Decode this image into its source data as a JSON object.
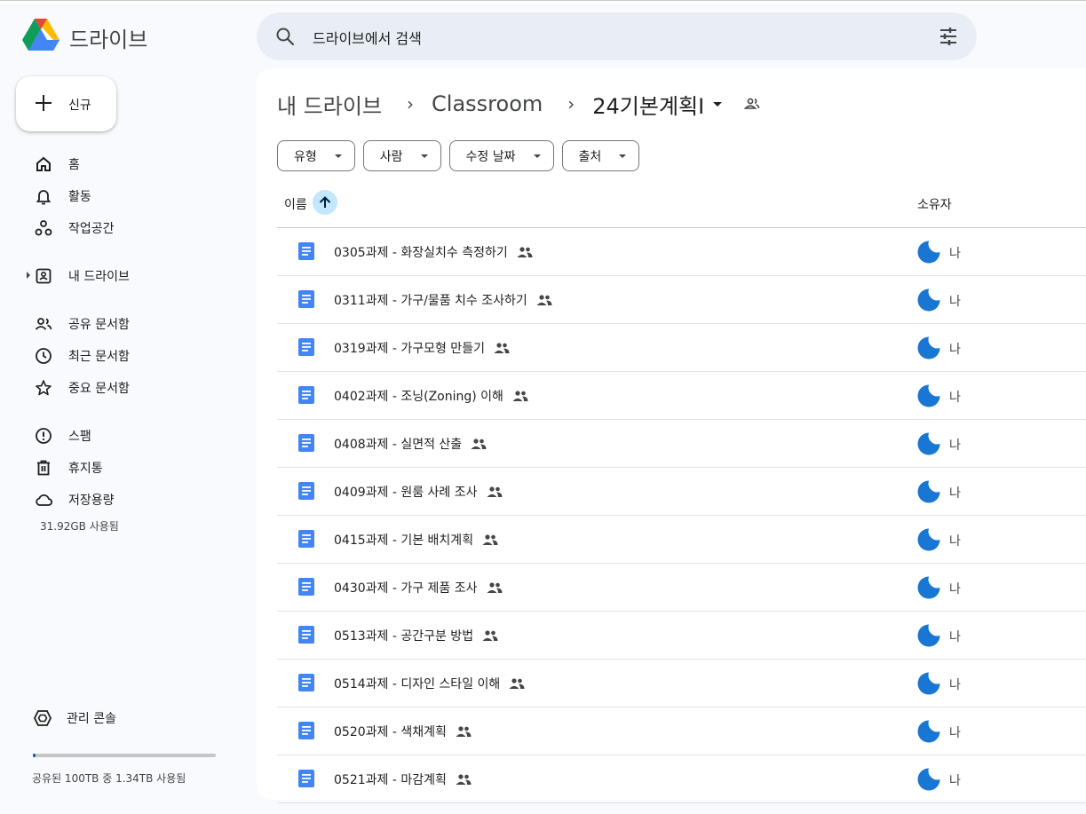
{
  "app": {
    "brand": "드라이브",
    "search_placeholder": "드라이브에서 검색",
    "icons": {
      "logo": "google-drive-logo",
      "search": "search-icon",
      "filter": "tune-icon"
    }
  },
  "sidebar": {
    "new_label": "신규",
    "items": [
      {
        "id": "home",
        "label": "홈",
        "icon": "home-icon"
      },
      {
        "id": "activity",
        "label": "활동",
        "icon": "bell-icon"
      },
      {
        "id": "workspaces",
        "label": "작업공간",
        "icon": "workspaces-icon"
      },
      {
        "id": "my-drive",
        "label": "내 드라이브",
        "icon": "my-drive-icon"
      },
      {
        "id": "shared",
        "label": "공유 문서함",
        "icon": "people-icon"
      },
      {
        "id": "recent",
        "label": "최근 문서함",
        "icon": "clock-icon"
      },
      {
        "id": "starred",
        "label": "중요 문서함",
        "icon": "star-icon"
      },
      {
        "id": "spam",
        "label": "스팸",
        "icon": "spam-icon"
      },
      {
        "id": "trash",
        "label": "휴지통",
        "icon": "trash-icon"
      },
      {
        "id": "storage",
        "label": "저장용량",
        "icon": "cloud-icon"
      }
    ],
    "storage_used": "31.92GB 사용됨",
    "admin_label": "관리 콘솔",
    "quota_text": "공유된 100TB 중 1.34TB 사용됨",
    "quota_fraction": 0.0134
  },
  "breadcrumb": {
    "items": [
      "내 드라이브",
      "Classroom",
      "24기본계획I"
    ]
  },
  "filters": [
    "유형",
    "사람",
    "수정 날짜",
    "출처"
  ],
  "columns": {
    "name": "이름",
    "owner": "소유자"
  },
  "files": [
    {
      "name": "0305과제 - 화장실치수 측정하기",
      "owner": "나"
    },
    {
      "name": "0311과제 - 가구/물품 치수 조사하기",
      "owner": "나"
    },
    {
      "name": "0319과제 - 가구모형 만들기",
      "owner": "나"
    },
    {
      "name": "0402과제 - 조닝(Zoning) 이해",
      "owner": "나"
    },
    {
      "name": "0408과제 - 실면적 산출",
      "owner": "나"
    },
    {
      "name": "0409과제 - 원룸 사례 조사",
      "owner": "나"
    },
    {
      "name": "0415과제 - 기본 배치계획",
      "owner": "나"
    },
    {
      "name": "0430과제 - 가구 제품 조사",
      "owner": "나"
    },
    {
      "name": "0513과제 - 공간구분 방법",
      "owner": "나"
    },
    {
      "name": "0514과제 - 디자인 스타일 이해",
      "owner": "나"
    },
    {
      "name": "0520과제 - 색채계획",
      "owner": "나"
    },
    {
      "name": "0521과제 - 마감계획",
      "owner": "나"
    }
  ],
  "colors": {
    "accent": "#0b57d0",
    "doc_blue": "#4285f4",
    "search_bg": "#e9eef6",
    "sort_bg": "#c2e7ff"
  }
}
